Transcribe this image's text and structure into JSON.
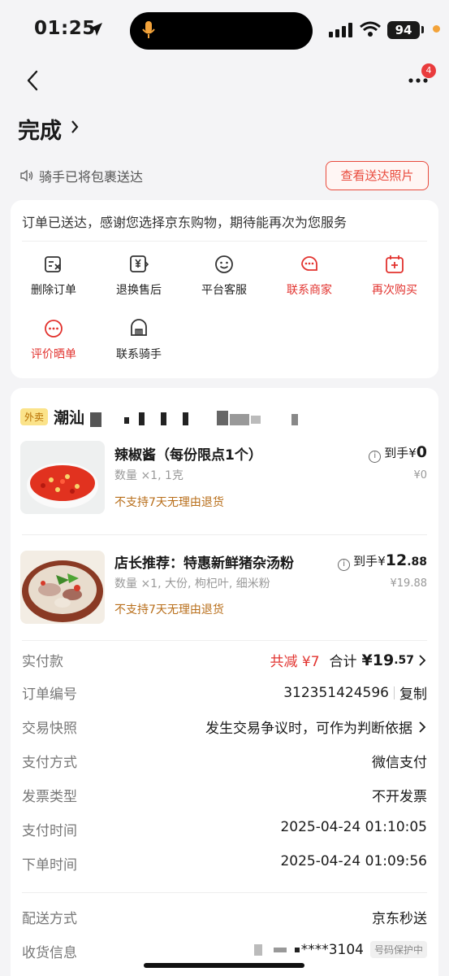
{
  "status_bar": {
    "time": "01:25",
    "battery": "94"
  },
  "nav": {
    "badge_count": "4"
  },
  "header": {
    "title": "完成"
  },
  "rider": {
    "message": "骑手已将包裹送达",
    "photo_button": "查看送达照片"
  },
  "actions_card": {
    "thanks": "订单已送达，感谢您选择京东购物，期待能再次为您服务",
    "items": [
      {
        "label": "删除订单",
        "icon": "delete-order-icon",
        "accent": false
      },
      {
        "label": "退换售后",
        "icon": "after-sale-icon",
        "accent": false
      },
      {
        "label": "平台客服",
        "icon": "customer-service-icon",
        "accent": false
      },
      {
        "label": "联系商家",
        "icon": "merchant-icon",
        "accent": true
      },
      {
        "label": "再次购买",
        "icon": "buy-again-icon",
        "accent": true
      },
      {
        "label": "评价晒单",
        "icon": "review-icon",
        "accent": true
      },
      {
        "label": "联系骑手",
        "icon": "rider-icon",
        "accent": false
      }
    ]
  },
  "order": {
    "shop_tag": "外卖",
    "shop_name": "潮汕",
    "products": [
      {
        "name": "辣椒酱（每份限点1个）",
        "spec": "数量 ×1, 1克",
        "warning": "不支持7天无理由退货",
        "price_label": "到手",
        "price_currency": "¥",
        "price_int": "0",
        "price_dec": "",
        "orig_price": "¥0"
      },
      {
        "name": "店长推荐：特惠新鲜猪杂汤粉",
        "spec": "数量 ×1, 大份, 枸杞叶, 细米粉",
        "warning": "不支持7天无理由退货",
        "price_label": "到手",
        "price_currency": "¥",
        "price_int": "12",
        "price_dec": ".88",
        "orig_price": "¥19.88"
      }
    ],
    "details": {
      "paid_label": "实付款",
      "discount": "共减 ¥7",
      "total_label": "合计",
      "total_int": "¥19",
      "total_dec": ".57",
      "order_no_label": "订单编号",
      "order_no": "312351424596",
      "copy": "复制",
      "snapshot_label": "交易快照",
      "snapshot_value": "发生交易争议时，可作为判断依据",
      "pay_method_label": "支付方式",
      "pay_method": "微信支付",
      "invoice_label": "发票类型",
      "invoice": "不开发票",
      "pay_time_label": "支付时间",
      "pay_time": "2025-04-24 01:10:05",
      "order_time_label": "下单时间",
      "order_time": "2025-04-24 01:09:56",
      "delivery_label": "配送方式",
      "delivery": "京东秒送",
      "receiver_label": "收货信息",
      "receiver_phone": "****3104",
      "phone_protect": "号码保护中"
    }
  },
  "colors": {
    "accent": "#e2332f",
    "warn": "#b86e1a",
    "background": "#f4f4f6"
  }
}
